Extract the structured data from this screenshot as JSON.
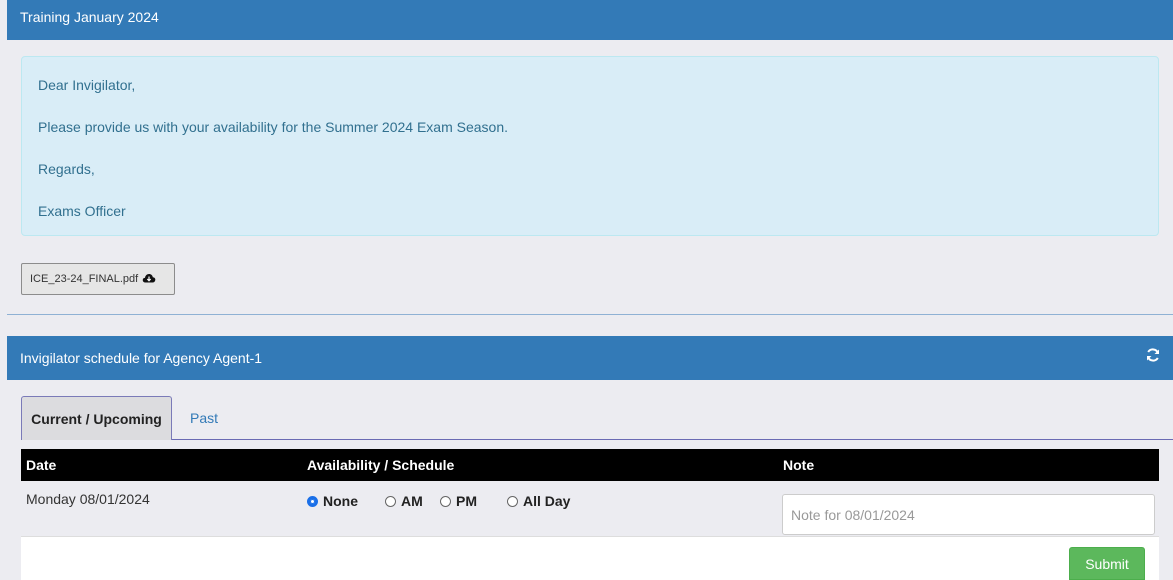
{
  "training_panel": {
    "title": "Training January 2024"
  },
  "message": {
    "greeting": "Dear Invigilator,",
    "body": "Please provide us with your availability for the Summer 2024 Exam Season.",
    "sign_off": "Regards,",
    "signature": "Exams Officer"
  },
  "attachment": {
    "label": "ICE_23-24_FINAL.pdf",
    "icon": "cloud-download-icon"
  },
  "schedule_panel": {
    "title": "Invigilator schedule for Agency Agent-1",
    "refresh_icon": "refresh-icon"
  },
  "tabs": [
    {
      "label": "Current / Upcoming",
      "active": true
    },
    {
      "label": "Past",
      "active": false
    }
  ],
  "table": {
    "columns": [
      "Date",
      "Availability / Schedule",
      "Note"
    ],
    "rows": [
      {
        "date": "Monday 08/01/2024",
        "options": [
          "None",
          "AM",
          "PM",
          "All Day"
        ],
        "selected": "None",
        "note_placeholder": "Note for 08/01/2024",
        "note_value": ""
      }
    ]
  },
  "submit_label": "Submit",
  "colors": {
    "header": "#337ab7",
    "alert_bg": "#d9edf7",
    "alert_text": "#31708f",
    "submit": "#5cb85c",
    "table_head": "#000000"
  }
}
